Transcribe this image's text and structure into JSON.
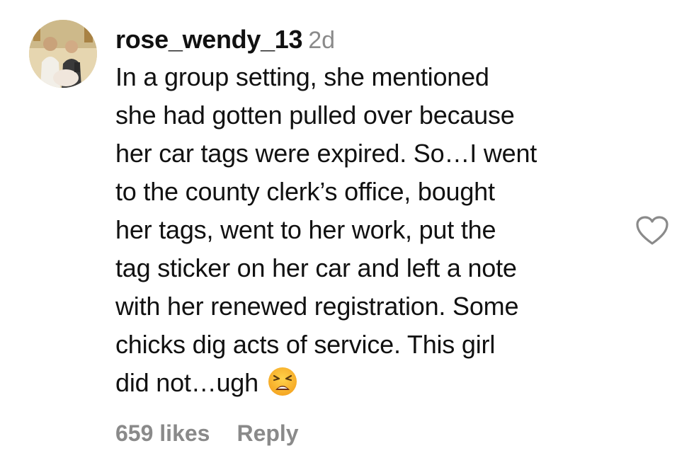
{
  "comment": {
    "avatar_icon": "user-avatar-photo",
    "username": "rose_wendy_13",
    "timestamp": "2d",
    "lines": [
      "In a group setting, she mentioned",
      "she had gotten pulled over because",
      "her car tags were expired. So…I went",
      "to the county clerk’s office, bought",
      "her tags, went to her work, put the",
      "tag sticker on her car and left a note",
      "with her renewed registration. Some",
      "chicks dig acts of service. This girl",
      "did not…ugh"
    ],
    "emoji": "weary-face-emoji",
    "likes": "659 likes",
    "reply_label": "Reply",
    "like_icon": "heart-outline-icon"
  },
  "colors": {
    "text": "#111111",
    "muted": "#8a8a8a",
    "background": "#ffffff"
  }
}
